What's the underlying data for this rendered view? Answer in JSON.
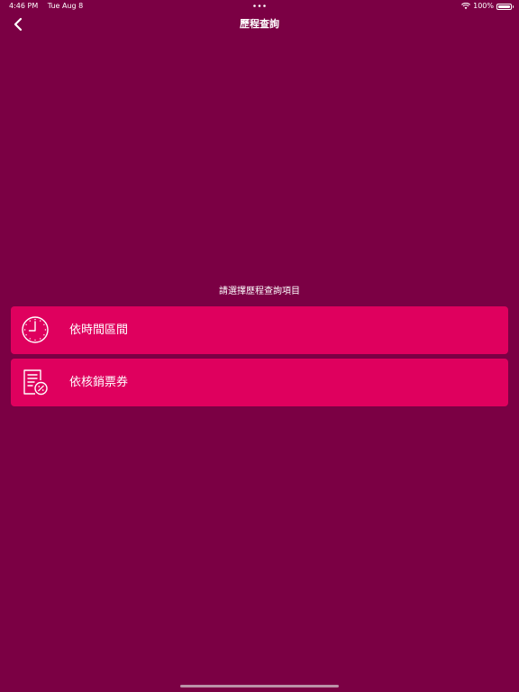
{
  "status_bar": {
    "time": "4:46 PM",
    "date": "Tue Aug 8",
    "battery_text": "100%",
    "wifi_icon": "wifi-icon",
    "battery_level": 1.0
  },
  "nav": {
    "title": "歷程查詢",
    "back_icon": "chevron-left-icon"
  },
  "main": {
    "prompt": "請選擇歷程查詢項目",
    "options": [
      {
        "label": "依時間區間",
        "icon": "clock-icon"
      },
      {
        "label": "依核銷票券",
        "icon": "ticket-receipt-icon"
      }
    ]
  },
  "colors": {
    "background": "#7b0044",
    "button": "#df005e",
    "text": "#ffffff"
  }
}
